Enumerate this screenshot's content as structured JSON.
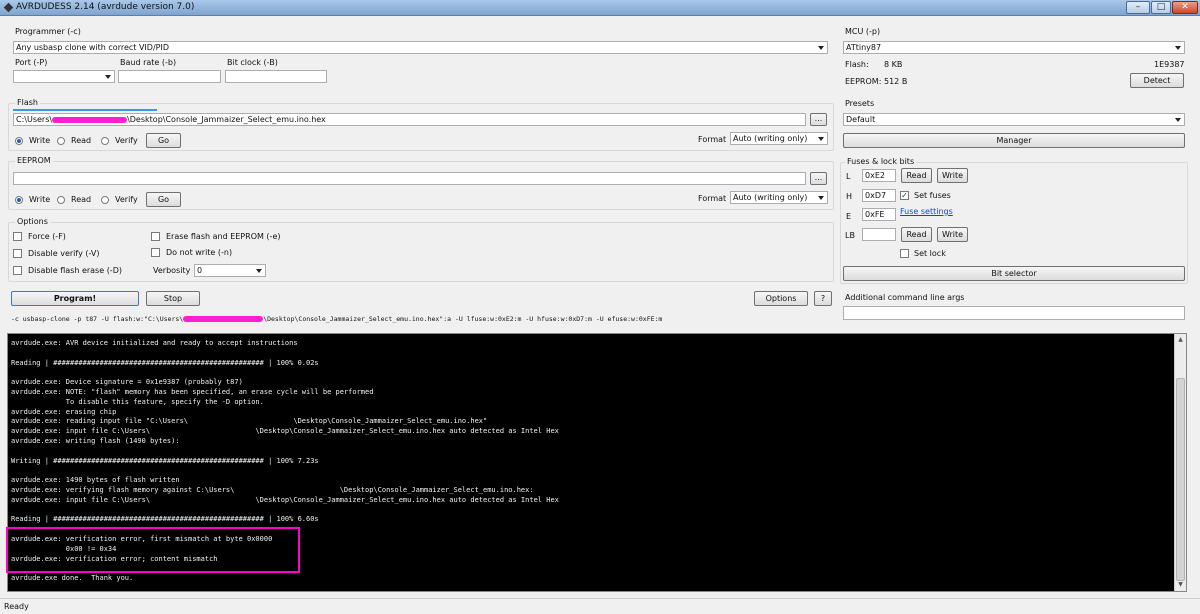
{
  "window": {
    "title": "AVRDUDESS 2.14 (avrdude version 7.0)",
    "minimize": "–",
    "maximize": "□",
    "close": "✕"
  },
  "programmer": {
    "label": "Programmer (-c)",
    "value": "Any usbasp clone with correct VID/PID",
    "port_label": "Port (-P)",
    "port_value": "",
    "baud_label": "Baud rate (-b)",
    "baud_value": "",
    "bitclock_label": "Bit clock (-B)",
    "bitclock_value": ""
  },
  "mcu": {
    "label": "MCU (-p)",
    "value": "ATtiny87",
    "flash_label": "Flash:",
    "flash_value": "8 KB",
    "signature": "1E9387",
    "eeprom_label": "EEPROM:",
    "eeprom_value": "512 B",
    "detect": "Detect"
  },
  "flash": {
    "label": "Flash",
    "path": "C:\\Users\\",
    "path_tail": "\\Desktop\\Console_Jammaizer_Select_emu.ino.hex",
    "browse": "...",
    "write": "Write",
    "read": "Read",
    "verify": "Verify",
    "go": "Go",
    "format_label": "Format",
    "format_value": "Auto (writing only)"
  },
  "eeprom": {
    "label": "EEPROM",
    "path": "",
    "browse": "...",
    "write": "Write",
    "read": "Read",
    "verify": "Verify",
    "go": "Go",
    "format_label": "Format",
    "format_value": "Auto (writing only)"
  },
  "presets": {
    "label": "Presets",
    "value": "Default",
    "manager": "Manager"
  },
  "fuses": {
    "label": "Fuses & lock bits",
    "l_label": "L",
    "l_value": "0xE2",
    "h_label": "H",
    "h_value": "0xD7",
    "e_label": "E",
    "e_value": "0xFE",
    "lb_label": "LB",
    "lb_value": "",
    "read": "Read",
    "write": "Write",
    "set_fuses": "Set fuses",
    "fuse_settings": "Fuse settings",
    "set_lock": "Set lock",
    "bit_selector": "Bit selector"
  },
  "options": {
    "label": "Options",
    "force": "Force (-F)",
    "disable_verify": "Disable verify (-V)",
    "disable_flash_erase": "Disable flash erase (-D)",
    "erase": "Erase flash and EEPROM (-e)",
    "do_not_write": "Do not write (-n)",
    "verbosity_label": "Verbosity",
    "verbosity_value": "0"
  },
  "actions": {
    "program": "Program!",
    "stop": "Stop",
    "options": "Options",
    "help": "?"
  },
  "additional_args_label": "Additional command line args",
  "command_line": "-c usbasp-clone -p t87 -U flash:w:\"C:\\Users\\",
  "command_line_tail": "\\Desktop\\Console_Jammaizer_Select_emu.ino.hex\":a -U lfuse:w:0xE2:m -U hfuse:w:0xD7:m -U efuse:w:0xFE:m",
  "console": [
    "avrdude.exe: AVR device initialized and ready to accept instructions",
    "",
    "Reading | ################################################## | 100% 0.02s",
    "",
    "avrdude.exe: Device signature = 0x1e9387 (probably t87)",
    "avrdude.exe: NOTE: \"flash\" memory has been specified, an erase cycle will be performed",
    "             To disable this feature, specify the -D option.",
    "avrdude.exe: erasing chip",
    "avrdude.exe: reading input file \"C:\\Users\\                         \\Desktop\\Console_Jammaizer_Select_emu.ino.hex\"",
    "avrdude.exe: input file C:\\Users\\                         \\Desktop\\Console_Jammaizer_Select_emu.ino.hex auto detected as Intel Hex",
    "avrdude.exe: writing flash (1490 bytes):",
    "",
    "Writing | ################################################## | 100% 7.23s",
    "",
    "avrdude.exe: 1490 bytes of flash written",
    "avrdude.exe: verifying flash memory against C:\\Users\\                         \\Desktop\\Console_Jammaizer_Select_emu.ino.hex:",
    "avrdude.exe: input file C:\\Users\\                         \\Desktop\\Console_Jammaizer_Select_emu.ino.hex auto detected as Intel Hex",
    "",
    "Reading | ################################################## | 100% 6.60s",
    "",
    "avrdude.exe: verification error, first mismatch at byte 0x0000",
    "             0x00 != 0x34",
    "avrdude.exe: verification error; content mismatch",
    "",
    "avrdude.exe done.  Thank you."
  ],
  "statusbar": "Ready",
  "colors": {
    "highlight": "#ff00cc",
    "redaction": "#ff1fd0",
    "accent": "#2a5cb0"
  }
}
